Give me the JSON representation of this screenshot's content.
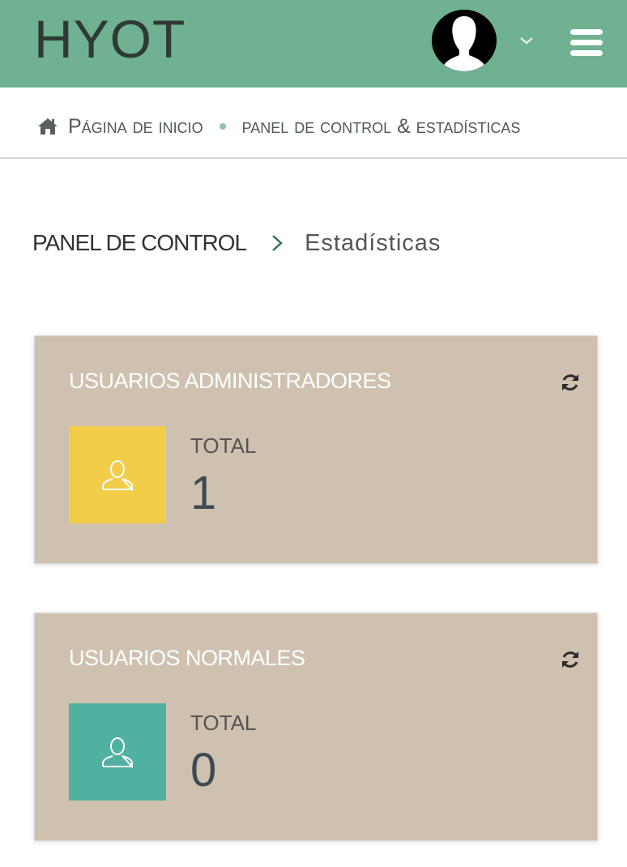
{
  "header": {
    "logo": "HYOT",
    "user_menu_icon": "chevron-down-icon",
    "menu_icon": "hamburger-menu-icon",
    "accent_color": "#6fb191"
  },
  "breadcrumb": {
    "home_label": "Página de inicio",
    "current_label": "panel de control & estadísticas"
  },
  "page_title": {
    "main": "PANEL DE CONTROL",
    "sub": "Estadísticas"
  },
  "cards": [
    {
      "title": "USUARIOS ADMINISTRADORES",
      "total_label": "TOTAL",
      "total_value": "1",
      "icon": "user-icon",
      "icon_color": "#f2cd4a"
    },
    {
      "title": "USUARIOS NORMALES",
      "total_label": "TOTAL",
      "total_value": "0",
      "icon": "user-icon",
      "icon_color": "#50b1a0"
    }
  ]
}
